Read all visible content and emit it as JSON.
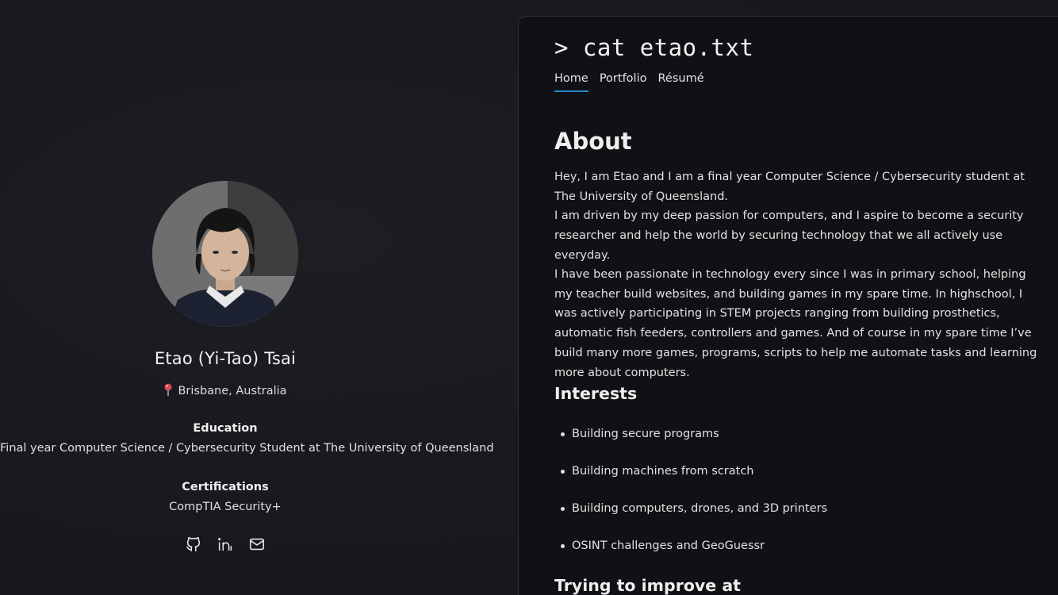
{
  "profile": {
    "name": "Etao (Yi-Tao) Tsai",
    "location": "Brisbane, Australia",
    "education_label": "Education",
    "education_value": "Final year Computer Science / Cybersecurity Student at The University of Queensland",
    "certifications_label": "Certifications",
    "certifications_value": "CompTIA Security+",
    "socials": [
      "github-icon",
      "linkedin-icon",
      "mail-icon"
    ]
  },
  "site": {
    "title": "> cat etao.txt",
    "nav": [
      {
        "label": "Home",
        "active": true
      },
      {
        "label": "Portfolio",
        "active": false
      },
      {
        "label": "Résumé",
        "active": false
      }
    ]
  },
  "about": {
    "heading": "About",
    "paragraph1_line1": "Hey, I am Etao and I am a final year Computer Science / Cybersecurity student at The University of Queensland.",
    "paragraph1_line2": "I am driven by my deep passion for computers, and I aspire to become a security researcher and help the world by securing technology that we all actively use everyday.",
    "paragraph2": "I have been passionate in technology every since I was in primary school, helping my teacher build websites, and building games in my spare time. In highschool, I was actively participating in STEM projects ranging from building prosthetics, automatic fish feeders, controllers and games. And of course in my spare time I’ve build many more games, programs, scripts to help me automate tasks and learning more about computers."
  },
  "interests": {
    "heading": "Interests",
    "items": [
      "Building secure programs",
      "Building machines from scratch",
      "Building computers, drones, and 3D printers",
      "OSINT challenges and GeoGuessr"
    ]
  },
  "improve": {
    "heading": "Trying to improve at"
  },
  "colors": {
    "background": "#17191d",
    "panel": "#0f1114",
    "accent": "#2a86c9"
  }
}
